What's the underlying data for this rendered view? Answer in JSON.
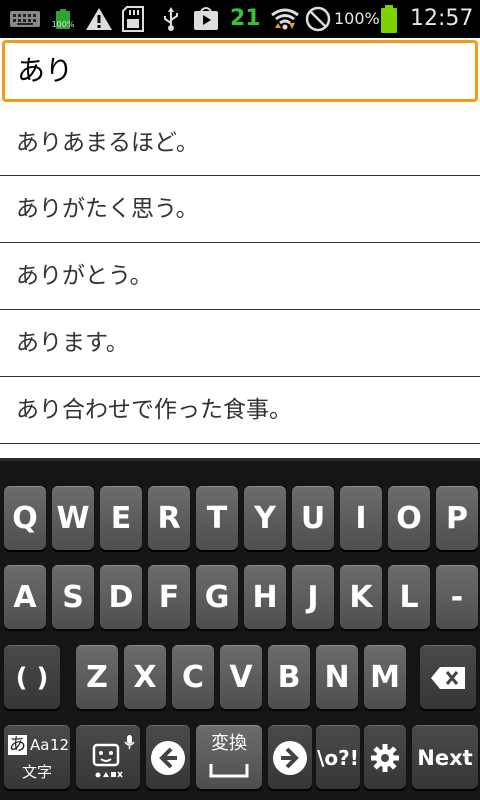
{
  "status_bar": {
    "icons": [
      "keyboard-icon",
      "battery-saver-icon",
      "warning-icon",
      "sd-card-icon",
      "usb-icon",
      "play-store-icon",
      "wifi-icon",
      "no-sim-icon",
      "battery-icon"
    ],
    "battery_saver_label": "100%",
    "badge_number": "21",
    "battery_percent": "100%",
    "time": "12:57"
  },
  "search": {
    "value": "あり"
  },
  "suggestions": [
    "ありあまるほど。",
    "ありがたく思う。",
    "ありがとう。",
    "あります。",
    "あり合わせで作った食事。"
  ],
  "keyboard": {
    "row1": [
      "Q",
      "W",
      "E",
      "R",
      "T",
      "Y",
      "U",
      "I",
      "O",
      "P"
    ],
    "row2": [
      "A",
      "S",
      "D",
      "F",
      "G",
      "H",
      "J",
      "K",
      "L",
      "-"
    ],
    "row3_paren": "( )",
    "row3": [
      "Z",
      "X",
      "C",
      "V",
      "B",
      "N",
      "M"
    ],
    "mode_key": {
      "kana": "あ",
      "alpha": "Aa",
      "num": "12",
      "label": "文字"
    },
    "convert_key": "変換",
    "symbols_key": "\\o?!",
    "next_key": "Next"
  },
  "colors": {
    "accent": "#f39c19",
    "statusbar_bg": "#000000",
    "keyboard_bg": "#151515",
    "key_bg": "#5e5e5e"
  }
}
